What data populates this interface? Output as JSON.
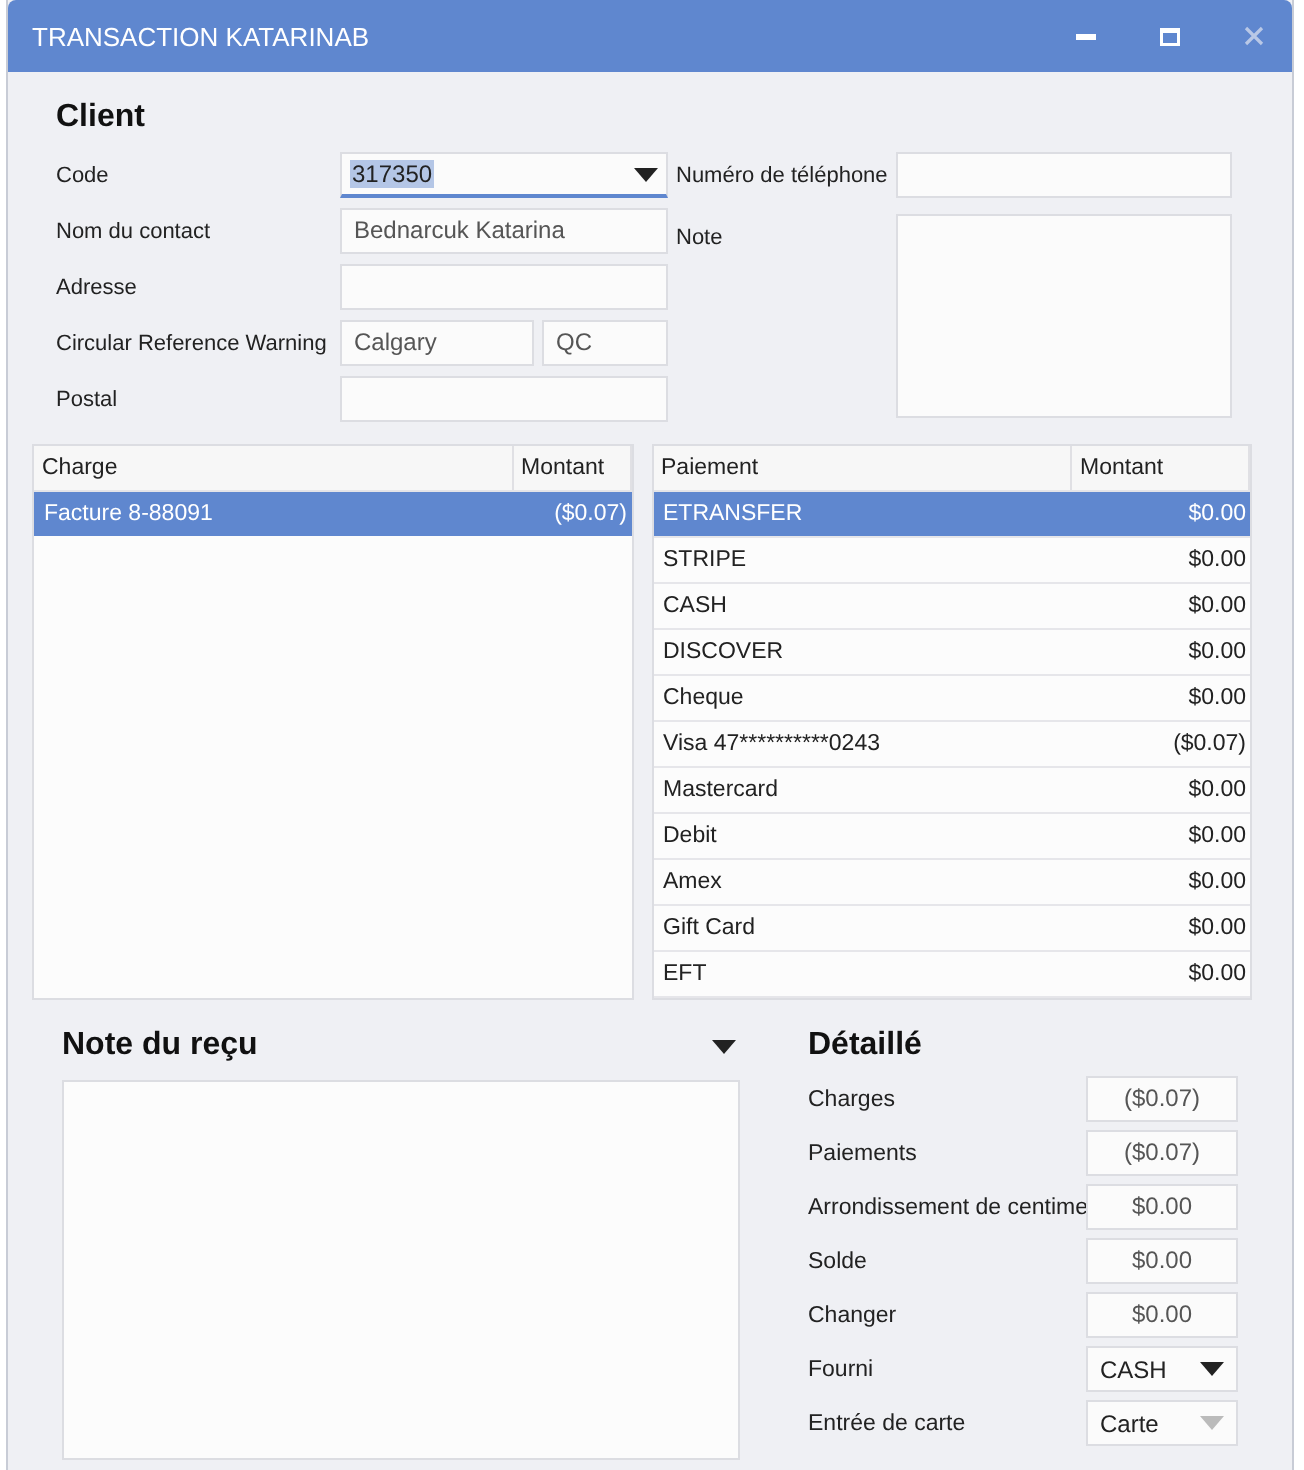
{
  "window": {
    "title": "TRANSACTION KATARINAB"
  },
  "client": {
    "heading": "Client",
    "left_fields": [
      {
        "label": "Code",
        "kind": "combo",
        "value": "317350",
        "value_highlighted": true
      },
      {
        "label": "Nom du contact",
        "kind": "readonly",
        "value": "Bednarcuk Katarina"
      },
      {
        "label": "Adresse",
        "kind": "readonly"
      },
      {
        "label": "Circular Reference Warning",
        "kind": "pair",
        "value": "Calgary",
        "value_2": "QC"
      },
      {
        "label": "Postal",
        "kind": "readonly"
      }
    ],
    "right_fields": [
      {
        "label": "Numéro de téléphone",
        "kind": "readonly"
      },
      {
        "label": "Note",
        "kind": "textarea"
      }
    ]
  },
  "charges_table": {
    "columns": [
      "Charge",
      "Montant"
    ],
    "rows": [
      {
        "cells": [
          "Facture 8-88091",
          "($0.07)"
        ],
        "selected": true
      }
    ]
  },
  "payments_table": {
    "columns": [
      "Paiement",
      "Montant"
    ],
    "rows": [
      {
        "cells": [
          "ETRANSFER",
          "$0.00"
        ],
        "selected": true
      },
      {
        "cells": [
          "STRIPE",
          "$0.00"
        ],
        "selected": false
      },
      {
        "cells": [
          "CASH",
          "$0.00"
        ],
        "selected": false
      },
      {
        "cells": [
          "DISCOVER",
          "$0.00"
        ],
        "selected": false
      },
      {
        "cells": [
          "Cheque",
          "$0.00"
        ],
        "selected": false
      },
      {
        "cells": [
          "Visa 47**********0243",
          "($0.07)"
        ],
        "selected": false
      },
      {
        "cells": [
          "Mastercard",
          "$0.00"
        ],
        "selected": false
      },
      {
        "cells": [
          "Debit",
          "$0.00"
        ],
        "selected": false
      },
      {
        "cells": [
          "Amex",
          "$0.00"
        ],
        "selected": false
      },
      {
        "cells": [
          "Gift Card",
          "$0.00"
        ],
        "selected": false
      },
      {
        "cells": [
          "EFT",
          "$0.00"
        ],
        "selected": false
      }
    ]
  },
  "receipt_note": {
    "heading": "Note du reçu"
  },
  "detail": {
    "heading": "Détaillé",
    "rows": [
      {
        "label": "Charges",
        "kind": "readonly",
        "value": "($0.07)"
      },
      {
        "label": "Paiements",
        "kind": "readonly",
        "value": "($0.07)"
      },
      {
        "label": "Arrondissement de centime",
        "kind": "readonly",
        "value": "$0.00"
      },
      {
        "label": "Solde",
        "kind": "readonly",
        "value": "$0.00"
      },
      {
        "label": "Changer",
        "kind": "readonly",
        "value": "$0.00"
      },
      {
        "label": "Fourni",
        "kind": "dropdown",
        "value": "CASH",
        "disabled": false
      },
      {
        "label": "Entrée de carte",
        "kind": "dropdown",
        "value": "Carte",
        "disabled": true
      }
    ]
  }
}
